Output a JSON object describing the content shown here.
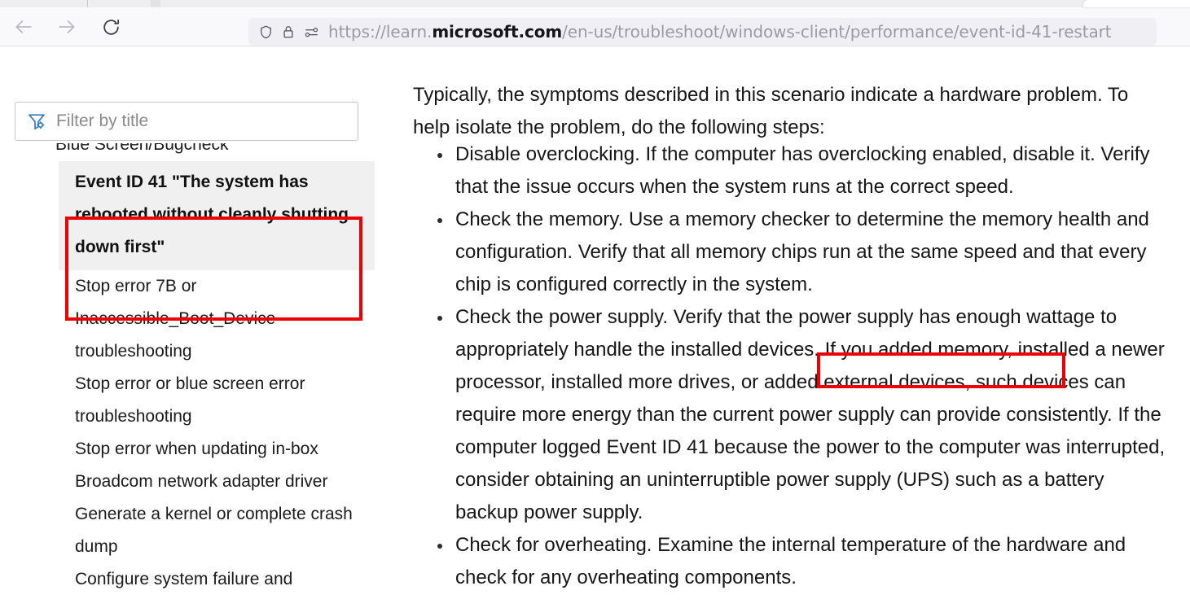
{
  "browser": {
    "back_icon": "arrow-left-icon",
    "forward_icon": "arrow-right-icon",
    "reload_icon": "reload-icon",
    "shield_icon": "shield-icon",
    "lock_icon": "lock-icon",
    "permissions_icon": "page-settings-icon",
    "url": {
      "scheme": "https://",
      "host_prefix": "learn.",
      "host_strong": "microsoft.com",
      "path": "/en-us/troubleshoot/windows-client/performance/event-id-41-restart",
      "full": "https://learn.microsoft.com/en-us/troubleshoot/windows-client/performance/event-id-41-restart"
    },
    "chrome_bg": "#f9f9fb",
    "urlbar_bg": "#f0f0f4"
  },
  "sidebar": {
    "filter": {
      "icon": "filter-funnel-icon",
      "placeholder": "Filter by title",
      "value": ""
    },
    "items": [
      {
        "label": "Blue Screen/Bugcheck",
        "state": "clipped"
      },
      {
        "label": "Event ID 41 \"The system has rebooted without cleanly shutting down first\"",
        "state": "active"
      },
      {
        "label": "Stop error 7B or Inaccessible_Boot_Device troubleshooting",
        "state": "normal"
      },
      {
        "label": "Stop error or blue screen error troubleshooting",
        "state": "normal"
      },
      {
        "label": "Stop error when updating in-box Broadcom network adapter driver",
        "state": "normal"
      },
      {
        "label": "Generate a kernel or complete crash dump",
        "state": "normal"
      },
      {
        "label": "Configure system failure and",
        "state": "normal"
      }
    ],
    "active_bg": "#f0f0f0"
  },
  "content": {
    "intro": "Typically, the symptoms described in this scenario indicate a hardware problem. To help isolate the problem, do the following steps:",
    "bullets": [
      "Disable overclocking. If the computer has overclocking enabled, disable it. Verify that the issue occurs when the system runs at the correct speed.",
      "Check the memory. Use a memory checker to determine the memory health and configuration. Verify that all memory chips run at the same speed and that every chip is configured correctly in the system.",
      "Check the power supply. Verify that the power supply has enough wattage to appropriately handle the installed devices. If you added memory, installed a newer processor, installed more drives, or added external devices, such devices can require more energy than the current power supply can provide consistently. If the computer logged Event ID 41 because the power to the computer was interrupted, consider obtaining an uninterruptible power supply (UPS) such as a battery backup power supply.",
      "Check for overheating. Examine the internal temperature of the hardware and check for any overheating components."
    ]
  },
  "annotations": {
    "color": "#ee0000",
    "boxes": [
      {
        "name": "annotation-hardware-problem",
        "target": "indicate a hardware problem."
      },
      {
        "name": "annotation-check-power-supply",
        "target": "Check the power supply."
      },
      {
        "name": "annotation-active-toc-item",
        "target": "Event ID 41 \"The system has rebooted without cleanly shutting down first\""
      }
    ]
  }
}
